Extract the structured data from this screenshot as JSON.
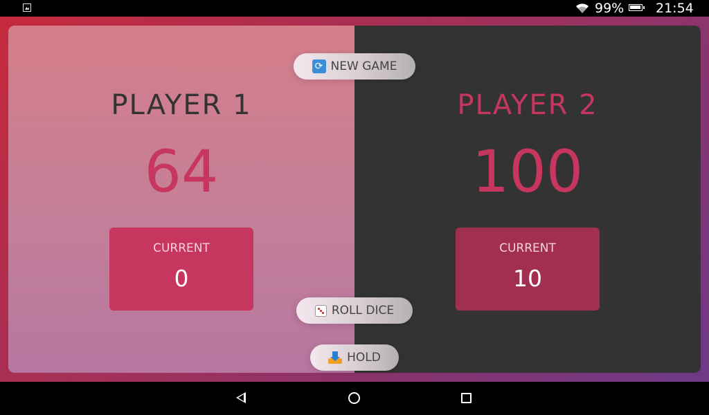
{
  "status_bar": {
    "battery_percent": "99%",
    "time": "21:54",
    "icons": [
      "image-notification-icon",
      "wifi-icon",
      "battery-icon"
    ]
  },
  "game": {
    "new_game_label": "NEW GAME",
    "roll_dice_label": "ROLL DICE",
    "hold_label": "HOLD",
    "players": [
      {
        "name": "PLAYER 1",
        "score": "64",
        "current_label": "CURRENT",
        "current_value": "0",
        "active": false
      },
      {
        "name": "PLAYER 2",
        "score": "100",
        "current_label": "CURRENT",
        "current_value": "10",
        "active": true
      }
    ]
  },
  "colors": {
    "accent": "#c7365f",
    "dark_panel": "#333333",
    "light_panel": "#d57e8a"
  },
  "nav_bar": {
    "icons": [
      "back-icon",
      "home-icon",
      "recent-apps-icon"
    ]
  }
}
